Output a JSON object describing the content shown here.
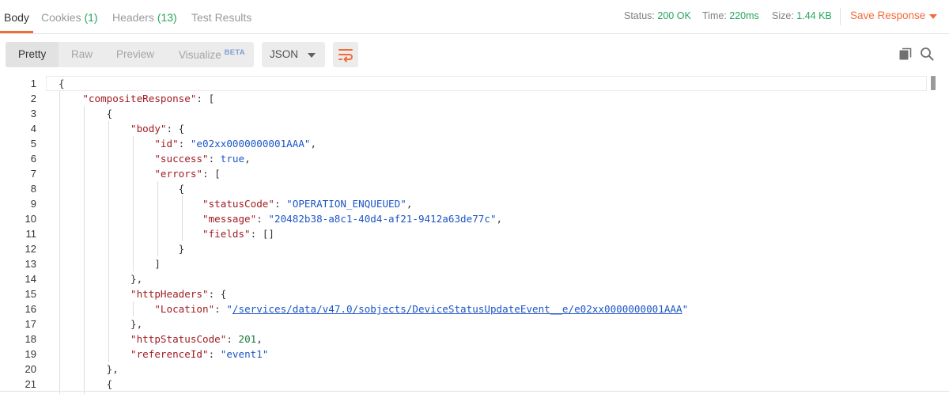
{
  "response_tabs": [
    {
      "label": "Body",
      "count": "",
      "active": true
    },
    {
      "label": "Cookies",
      "count": "(1)",
      "active": false
    },
    {
      "label": "Headers",
      "count": "(13)",
      "active": false
    },
    {
      "label": "Test Results",
      "count": "",
      "active": false
    }
  ],
  "meta": {
    "status_label": "Status:",
    "status_value": "200 OK",
    "time_label": "Time:",
    "time_value": "220ms",
    "size_label": "Size:",
    "size_value": "1.44 KB"
  },
  "save_response": "Save Response",
  "view_tabs": {
    "pretty": "Pretty",
    "raw": "Raw",
    "preview": "Preview",
    "visualize": "Visualize",
    "beta": "BETA"
  },
  "format": {
    "selected": "JSON"
  },
  "icons": {
    "wrap": "wrap-lines-icon",
    "copy": "copy-icon",
    "search": "search-icon",
    "accent": "#f26b3a"
  },
  "code": {
    "line_numbers": [
      "1",
      "2",
      "3",
      "4",
      "5",
      "6",
      "7",
      "8",
      "9",
      "10",
      "11",
      "12",
      "13",
      "14",
      "15",
      "16",
      "17",
      "18",
      "19",
      "20",
      "21"
    ],
    "tokens": {
      "composite_key": "\"compositeResponse\"",
      "body_key": "\"body\"",
      "id_key": "\"id\"",
      "id_value": "\"e02xx0000000001AAA\"",
      "success_key": "\"success\"",
      "success_value": "true",
      "errors_key": "\"errors\"",
      "status_code_key": "\"statusCode\"",
      "status_code_value": "\"OPERATION_ENQUEUED\"",
      "message_key": "\"message\"",
      "message_value": "\"20482b38-a8c1-40d4-af21-9412a63de77c\"",
      "fields_key": "\"fields\"",
      "http_headers_key": "\"httpHeaders\"",
      "location_key": "\"Location\"",
      "location_value": "/services/data/v47.0/sobjects/DeviceStatusUpdateEvent__e/e02xx0000000001AAA",
      "http_status_code_key": "\"httpStatusCode\"",
      "http_status_code_value": "201",
      "reference_id_key": "\"referenceId\"",
      "reference_id_value": "\"event1\""
    }
  }
}
